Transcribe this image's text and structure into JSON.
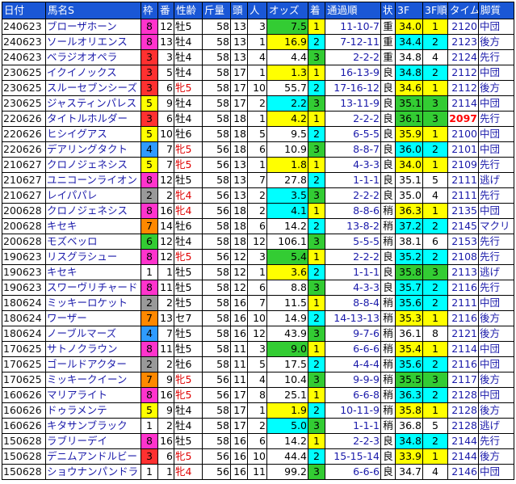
{
  "headers": [
    "日付",
    "馬名S",
    "枠",
    "番",
    "性齢",
    "斤量",
    "頭",
    "人",
    "オッズ",
    "着",
    "通過順",
    "状",
    "3F",
    "3F順",
    "タイム",
    "脚質"
  ],
  "rows": [
    {
      "date": "240623",
      "name": "ブローザホーン",
      "frame": "8",
      "num": "12",
      "sex": "牡5",
      "weight": "58",
      "heads": "13",
      "pop": "3",
      "odds": "7.5",
      "rank": "1",
      "pass": "11-10-7",
      "cond": "重",
      "f3": "34.0",
      "f3r": "1",
      "time": "2120",
      "style": "中団"
    },
    {
      "date": "240623",
      "name": "ソールオリエンス",
      "frame": "8",
      "num": "13",
      "sex": "牡4",
      "weight": "58",
      "heads": "13",
      "pop": "1",
      "odds": "16.9",
      "rank": "2",
      "pass": "7-12-11",
      "cond": "重",
      "f3": "34.4",
      "f3r": "2",
      "time": "2123",
      "style": "後方"
    },
    {
      "date": "240623",
      "name": "ベラジオオペラ",
      "frame": "3",
      "num": "3",
      "sex": "牡4",
      "weight": "58",
      "heads": "13",
      "pop": "4",
      "odds": "4.4",
      "rank": "3",
      "pass": "2-2-2",
      "cond": "重",
      "f3": "34.8",
      "f3r": "4",
      "time": "2124",
      "style": "先行"
    },
    {
      "date": "230625",
      "name": "イクイノックス",
      "frame": "3",
      "num": "5",
      "sex": "牡4",
      "weight": "58",
      "heads": "17",
      "pop": "1",
      "odds": "1.3",
      "rank": "1",
      "pass": "16-13-9",
      "cond": "良",
      "f3": "34.8",
      "f3r": "2",
      "time": "2112",
      "style": "中団"
    },
    {
      "date": "230625",
      "name": "スルーセブンシーズ",
      "frame": "3",
      "num": "6",
      "sex": "牝5",
      "weight": "58",
      "heads": "17",
      "pop": "10",
      "odds": "55.7",
      "rank": "2",
      "pass": "17-16-12",
      "cond": "良",
      "f3": "34.6",
      "f3r": "1",
      "time": "2112",
      "style": "後方"
    },
    {
      "date": "230625",
      "name": "ジャスティンパレス",
      "frame": "5",
      "num": "9",
      "sex": "牡4",
      "weight": "58",
      "heads": "17",
      "pop": "2",
      "odds": "2.2",
      "rank": "3",
      "pass": "13-11-9",
      "cond": "良",
      "f3": "35.1",
      "f3r": "3",
      "time": "2114",
      "style": "中団"
    },
    {
      "date": "220626",
      "name": "タイトルホルダー",
      "frame": "3",
      "num": "6",
      "sex": "牡4",
      "weight": "58",
      "heads": "18",
      "pop": "1",
      "odds": "4.2",
      "rank": "1",
      "pass": "2-2-2",
      "cond": "良",
      "f3": "36.1",
      "f3r": "3",
      "time": "2097",
      "style": "先行"
    },
    {
      "date": "220626",
      "name": "ヒシイグアス",
      "frame": "5",
      "num": "10",
      "sex": "牡6",
      "weight": "58",
      "heads": "18",
      "pop": "5",
      "odds": "9.5",
      "rank": "2",
      "pass": "6-5-5",
      "cond": "良",
      "f3": "35.9",
      "f3r": "1",
      "time": "2100",
      "style": "中団"
    },
    {
      "date": "220626",
      "name": "デアリングタクト",
      "frame": "4",
      "num": "7",
      "sex": "牝5",
      "weight": "56",
      "heads": "18",
      "pop": "6",
      "odds": "10.9",
      "rank": "3",
      "pass": "8-8-7",
      "cond": "良",
      "f3": "36.0",
      "f3r": "2",
      "time": "2101",
      "style": "中団"
    },
    {
      "date": "210627",
      "name": "クロノジェネシス",
      "frame": "5",
      "num": "7",
      "sex": "牝5",
      "weight": "56",
      "heads": "13",
      "pop": "1",
      "odds": "1.8",
      "rank": "1",
      "pass": "4-3-3",
      "cond": "良",
      "f3": "34.0",
      "f3r": "1",
      "time": "2109",
      "style": "先行"
    },
    {
      "date": "210627",
      "name": "ユニコーンライオン",
      "frame": "8",
      "num": "12",
      "sex": "牡5",
      "weight": "58",
      "heads": "13",
      "pop": "7",
      "odds": "27.8",
      "rank": "2",
      "pass": "1-1-1",
      "cond": "良",
      "f3": "35.1",
      "f3r": "5",
      "time": "2111",
      "style": "逃げ"
    },
    {
      "date": "210627",
      "name": "レイパパレ",
      "frame": "2",
      "num": "2",
      "sex": "牝4",
      "weight": "56",
      "heads": "13",
      "pop": "2",
      "odds": "3.5",
      "rank": "3",
      "pass": "2-2-2",
      "cond": "良",
      "f3": "35.0",
      "f3r": "4",
      "time": "2111",
      "style": "先行"
    },
    {
      "date": "200628",
      "name": "クロノジェネシス",
      "frame": "8",
      "num": "16",
      "sex": "牝4",
      "weight": "56",
      "heads": "18",
      "pop": "2",
      "odds": "4.1",
      "rank": "1",
      "pass": "8-8-6",
      "cond": "稍",
      "f3": "36.3",
      "f3r": "1",
      "time": "2135",
      "style": "中団"
    },
    {
      "date": "200628",
      "name": "キセキ",
      "frame": "7",
      "num": "14",
      "sex": "牡6",
      "weight": "58",
      "heads": "18",
      "pop": "6",
      "odds": "14.2",
      "rank": "2",
      "pass": "13-8-2",
      "cond": "稍",
      "f3": "37.2",
      "f3r": "2",
      "time": "2145",
      "style": "マクリ"
    },
    {
      "date": "200628",
      "name": "モズベッロ",
      "frame": "6",
      "num": "12",
      "sex": "牡4",
      "weight": "58",
      "heads": "18",
      "pop": "12",
      "odds": "106.1",
      "rank": "3",
      "pass": "5-5-5",
      "cond": "稍",
      "f3": "38.1",
      "f3r": "6",
      "time": "2153",
      "style": "先行"
    },
    {
      "date": "190623",
      "name": "リスグラシュー",
      "frame": "8",
      "num": "12",
      "sex": "牝5",
      "weight": "56",
      "heads": "12",
      "pop": "3",
      "odds": "5.4",
      "rank": "1",
      "pass": "2-2-2",
      "cond": "良",
      "f3": "35.2",
      "f3r": "2",
      "time": "2108",
      "style": "先行"
    },
    {
      "date": "190623",
      "name": "キセキ",
      "frame": "1",
      "num": "1",
      "sex": "牡5",
      "weight": "58",
      "heads": "12",
      "pop": "1",
      "odds": "3.6",
      "rank": "2",
      "pass": "1-1-1",
      "cond": "良",
      "f3": "35.8",
      "f3r": "3",
      "time": "2113",
      "style": "逃げ"
    },
    {
      "date": "190623",
      "name": "スワーヴリチャード",
      "frame": "8",
      "num": "11",
      "sex": "牡5",
      "weight": "58",
      "heads": "12",
      "pop": "6",
      "odds": "8.8",
      "rank": "3",
      "pass": "4-3-3",
      "cond": "良",
      "f3": "35.7",
      "f3r": "2",
      "time": "2116",
      "style": "先行"
    },
    {
      "date": "180624",
      "name": "ミッキーロケット",
      "frame": "2",
      "num": "2",
      "sex": "牡5",
      "weight": "58",
      "heads": "16",
      "pop": "7",
      "odds": "11.5",
      "rank": "1",
      "pass": "8-8-4",
      "cond": "稍",
      "f3": "35.6",
      "f3r": "2",
      "time": "2111",
      "style": "中団"
    },
    {
      "date": "180624",
      "name": "ワーザー",
      "frame": "7",
      "num": "13",
      "sex": "セ7",
      "weight": "58",
      "heads": "16",
      "pop": "10",
      "odds": "14.9",
      "rank": "2",
      "pass": "14-13-13",
      "cond": "稍",
      "f3": "35.3",
      "f3r": "1",
      "time": "2116",
      "style": "後方"
    },
    {
      "date": "180624",
      "name": "ノーブルマーズ",
      "frame": "4",
      "num": "7",
      "sex": "牡5",
      "weight": "58",
      "heads": "16",
      "pop": "12",
      "odds": "43.9",
      "rank": "3",
      "pass": "9-7-6",
      "cond": "稍",
      "f3": "36.1",
      "f3r": "8",
      "time": "2121",
      "style": "後方"
    },
    {
      "date": "170625",
      "name": "サトノクラウン",
      "frame": "8",
      "num": "11",
      "sex": "牡5",
      "weight": "58",
      "heads": "11",
      "pop": "3",
      "odds": "9.0",
      "rank": "1",
      "pass": "6-6-6",
      "cond": "稍",
      "f3": "35.4",
      "f3r": "1",
      "time": "2114",
      "style": "中団"
    },
    {
      "date": "170625",
      "name": "ゴールドアクター",
      "frame": "2",
      "num": "2",
      "sex": "牡6",
      "weight": "58",
      "heads": "11",
      "pop": "5",
      "odds": "17.5",
      "rank": "2",
      "pass": "4-4-4",
      "cond": "稍",
      "f3": "35.6",
      "f3r": "2",
      "time": "2116",
      "style": "中団"
    },
    {
      "date": "170625",
      "name": "ミッキークイーン",
      "frame": "7",
      "num": "9",
      "sex": "牝5",
      "weight": "56",
      "heads": "11",
      "pop": "4",
      "odds": "10.4",
      "rank": "3",
      "pass": "9-9-9",
      "cond": "稍",
      "f3": "35.5",
      "f3r": "3",
      "time": "2117",
      "style": "後方"
    },
    {
      "date": "160626",
      "name": "マリアライト",
      "frame": "8",
      "num": "16",
      "sex": "牝5",
      "weight": "56",
      "heads": "17",
      "pop": "8",
      "odds": "25.1",
      "rank": "1",
      "pass": "6-6-8",
      "cond": "稍",
      "f3": "36.3",
      "f3r": "2",
      "time": "2128",
      "style": "中団"
    },
    {
      "date": "160626",
      "name": "ドゥラメンテ",
      "frame": "5",
      "num": "9",
      "sex": "牡4",
      "weight": "58",
      "heads": "17",
      "pop": "1",
      "odds": "1.9",
      "rank": "2",
      "pass": "10-11-9",
      "cond": "稍",
      "f3": "35.8",
      "f3r": "1",
      "time": "2128",
      "style": "後方"
    },
    {
      "date": "160626",
      "name": "キタサンブラック",
      "frame": "1",
      "num": "2",
      "sex": "牡4",
      "weight": "58",
      "heads": "17",
      "pop": "2",
      "odds": "5.0",
      "rank": "3",
      "pass": "1-1-1",
      "cond": "稍",
      "f3": "36.8",
      "f3r": "5",
      "time": "2128",
      "style": "逃げ"
    },
    {
      "date": "150628",
      "name": "ラブリーデイ",
      "frame": "8",
      "num": "16",
      "sex": "牡5",
      "weight": "58",
      "heads": "16",
      "pop": "6",
      "odds": "14.2",
      "rank": "1",
      "pass": "2-2-3",
      "cond": "良",
      "f3": "34.8",
      "f3r": "2",
      "time": "2144",
      "style": "先行"
    },
    {
      "date": "150628",
      "name": "デニムアンドルビー",
      "frame": "3",
      "num": "6",
      "sex": "牝5",
      "weight": "56",
      "heads": "16",
      "pop": "10",
      "odds": "44.4",
      "rank": "2",
      "pass": "15-15-14",
      "cond": "良",
      "f3": "33.9",
      "f3r": "1",
      "time": "2144",
      "style": "後方"
    },
    {
      "date": "150628",
      "name": "ショウナンパンドラ",
      "frame": "1",
      "num": "1",
      "sex": "牝4",
      "weight": "56",
      "heads": "16",
      "pop": "11",
      "odds": "99.2",
      "rank": "3",
      "pass": "6-6-6",
      "cond": "良",
      "f3": "34.7",
      "f3r": "4",
      "time": "2146",
      "style": "中団"
    }
  ]
}
